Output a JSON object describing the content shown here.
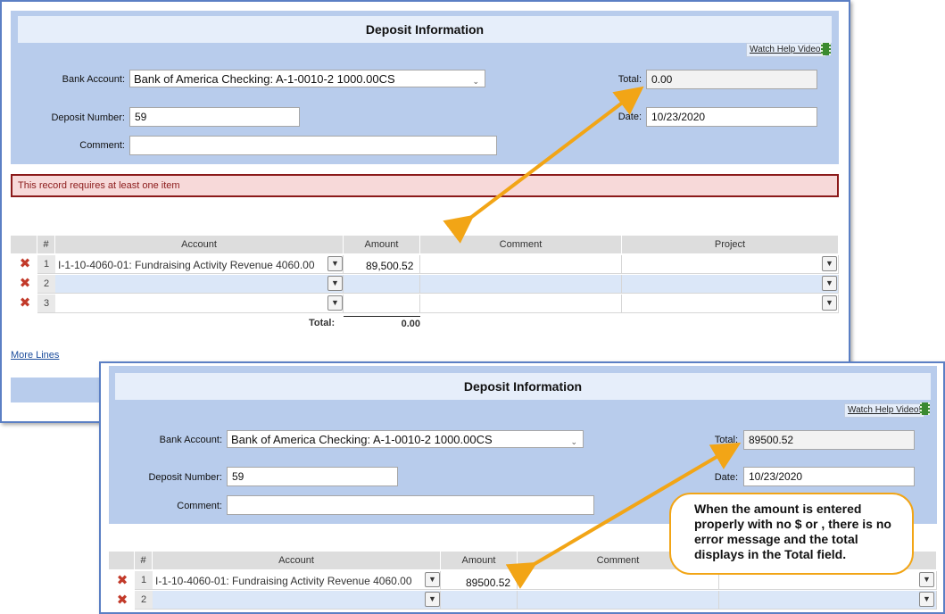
{
  "top": {
    "title": "Deposit Information",
    "help_link": "Watch Help Video!",
    "bank_account_label": "Bank Account:",
    "bank_account_value": "Bank of America Checking: A-1-0010-2 1000.00CS",
    "deposit_number_label": "Deposit Number:",
    "deposit_number_value": "59",
    "comment_label": "Comment:",
    "comment_value": "",
    "total_label": "Total:",
    "total_value": "0.00",
    "date_label": "Date:",
    "date_value": "10/23/2020",
    "error_message": "This record requires at least one item",
    "grid": {
      "columns": [
        "#",
        "Account",
        "Amount",
        "Comment",
        "Project"
      ],
      "rows": [
        {
          "num": "1",
          "account": "I-1-10-4060-01: Fundraising Activity Revenue 4060.00",
          "amount": "89,500.52"
        },
        {
          "num": "2",
          "account": "",
          "amount": ""
        },
        {
          "num": "3",
          "account": "",
          "amount": ""
        }
      ],
      "total_label": "Total:",
      "total_value": "0.00"
    },
    "more_lines": "More Lines"
  },
  "bottom": {
    "title": "Deposit Information",
    "help_link": "Watch Help Video!",
    "bank_account_label": "Bank Account:",
    "bank_account_value": "Bank of America Checking: A-1-0010-2 1000.00CS",
    "deposit_number_label": "Deposit Number:",
    "deposit_number_value": "59",
    "comment_label": "Comment:",
    "comment_value": "",
    "total_label": "Total:",
    "total_value": "89500.52",
    "date_label": "Date:",
    "date_value": "10/23/2020",
    "grid": {
      "columns": [
        "#",
        "Account",
        "Amount",
        "Comment"
      ],
      "rows": [
        {
          "num": "1",
          "account": "I-1-10-4060-01: Fundraising Activity Revenue 4060.00",
          "amount": "89500.52"
        },
        {
          "num": "2",
          "account": "",
          "amount": ""
        }
      ]
    }
  },
  "callout": {
    "text": "When the amount is entered properly with no $ or , there is no error message and the total displays in the Total field."
  },
  "colors": {
    "panel": "#b8ccec",
    "window_border": "#5b7fc4",
    "error_border": "#8b1a1a",
    "arrow": "#f2a516"
  }
}
